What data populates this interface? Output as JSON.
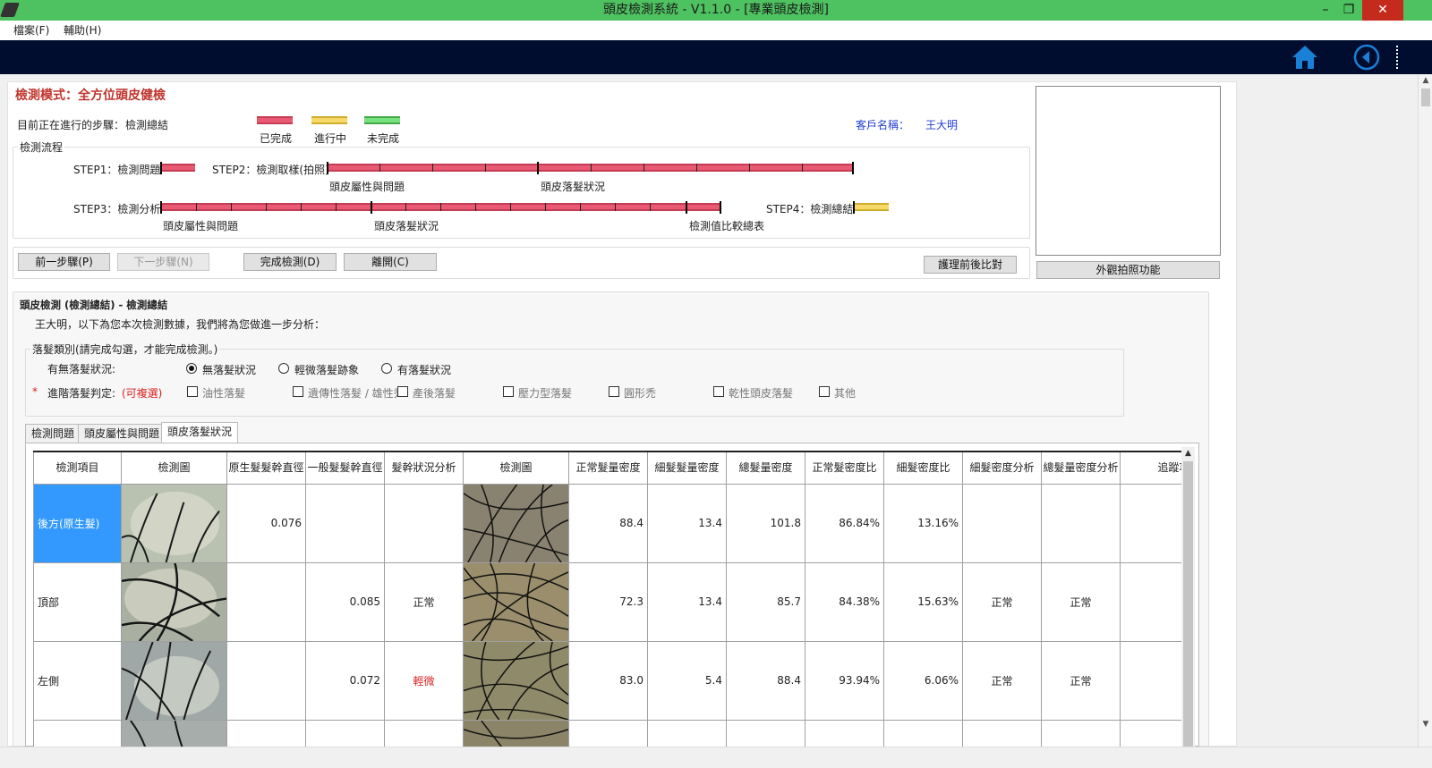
{
  "window": {
    "title": "頭皮檢測系統 - V1.1.0 - [專業頭皮檢測]",
    "minimize": "–",
    "restore": "❐",
    "close": "✕"
  },
  "menu": [
    "檔案(F)",
    "輔助(H)"
  ],
  "nav": {
    "home_icon": "home-icon",
    "back_icon": "back-circle-icon",
    "accent": "#1a7fd6"
  },
  "header": {
    "mode": "檢測模式：全方位頭皮健檢",
    "current_step_label": "目前正在進行的步驟：",
    "current_step": "檢測總結",
    "client_label": "客戶名稱：",
    "client_name": "王大明"
  },
  "legend": {
    "done": "已完成",
    "in_progress": "進行中",
    "not_done": "未完成"
  },
  "flow": {
    "group_label": "檢測流程",
    "step1": "STEP1：檢測問題",
    "step2": "STEP2：檢測取樣(拍照)",
    "step2_sub1": "頭皮屬性與問題",
    "step2_sub2": "頭皮落髮狀況",
    "step3": "STEP3：檢測分析",
    "step3_sub1": "頭皮屬性與問題",
    "step3_sub2": "頭皮落髮狀況",
    "step3_sub3": "檢測值比較總表",
    "step4": "STEP4：檢測總結"
  },
  "buttons": {
    "prev": "前一步驟(P)",
    "next": "下一步驟(N)",
    "finish": "完成檢測(D)",
    "leave": "離開(C)",
    "compare": "護理前後比對",
    "photo": "外觀拍照功能"
  },
  "summary": {
    "title": "頭皮檢測 (檢測總結) - 檢測總結",
    "intro": "王大明，以下為您本次檢測數據，我們將為您做進一步分析：",
    "group_label": "落髮類別(請完成勾選，才能完成檢測。)",
    "hairloss_label": "有無落髮狀況:",
    "radio": [
      "無落髮狀況",
      "輕微落髮跡象",
      "有落髮狀況"
    ],
    "radio_selected": 0,
    "required_mark": "*",
    "advanced_label": "進階落髮判定:",
    "advanced_hint": "(可複選)",
    "checks": [
      "油性落髮",
      "遺傳性落髮 / 雄性禿",
      "產後落髮",
      "壓力型落髮",
      "圓形禿",
      "乾性頭皮落髮",
      "其他"
    ]
  },
  "tabs": [
    "檢測問題",
    "頭皮屬性與問題",
    "頭皮落髮狀況"
  ],
  "active_tab": 2,
  "table": {
    "headers": [
      "檢測項目",
      "檢測圖",
      "原生髮髮幹直徑",
      "一般髮髮幹直徑",
      "髮幹狀況分析",
      "檢測圖",
      "正常髮量密度",
      "細髮髮量密度",
      "總髮量密度",
      "正常髮密度比",
      "細髮密度比",
      "細髮密度分析",
      "總髮量密度分析",
      "追蹤項目"
    ],
    "rows": [
      {
        "item": "後方(原生髮)",
        "orig_diam": "0.076",
        "norm_diam": "",
        "shaft": "",
        "normal_density": "88.4",
        "fine_density": "13.4",
        "total_density": "101.8",
        "normal_ratio": "86.84%",
        "fine_ratio": "13.16%",
        "fine_analysis": "",
        "total_analysis": "",
        "track": "",
        "selected": true
      },
      {
        "item": "頂部",
        "orig_diam": "",
        "norm_diam": "0.085",
        "shaft": "正常",
        "normal_density": "72.3",
        "fine_density": "13.4",
        "total_density": "85.7",
        "normal_ratio": "84.38%",
        "fine_ratio": "15.63%",
        "fine_analysis": "正常",
        "total_analysis": "正常",
        "track": "",
        "selected": false
      },
      {
        "item": "左側",
        "orig_diam": "",
        "norm_diam": "0.072",
        "shaft": "輕微",
        "normal_density": "83.0",
        "fine_density": "5.4",
        "total_density": "88.4",
        "normal_ratio": "93.94%",
        "fine_ratio": "6.06%",
        "fine_analysis": "正常",
        "total_analysis": "正常",
        "track": "",
        "selected": false,
        "shaft_color": "#d81f1f"
      }
    ]
  }
}
